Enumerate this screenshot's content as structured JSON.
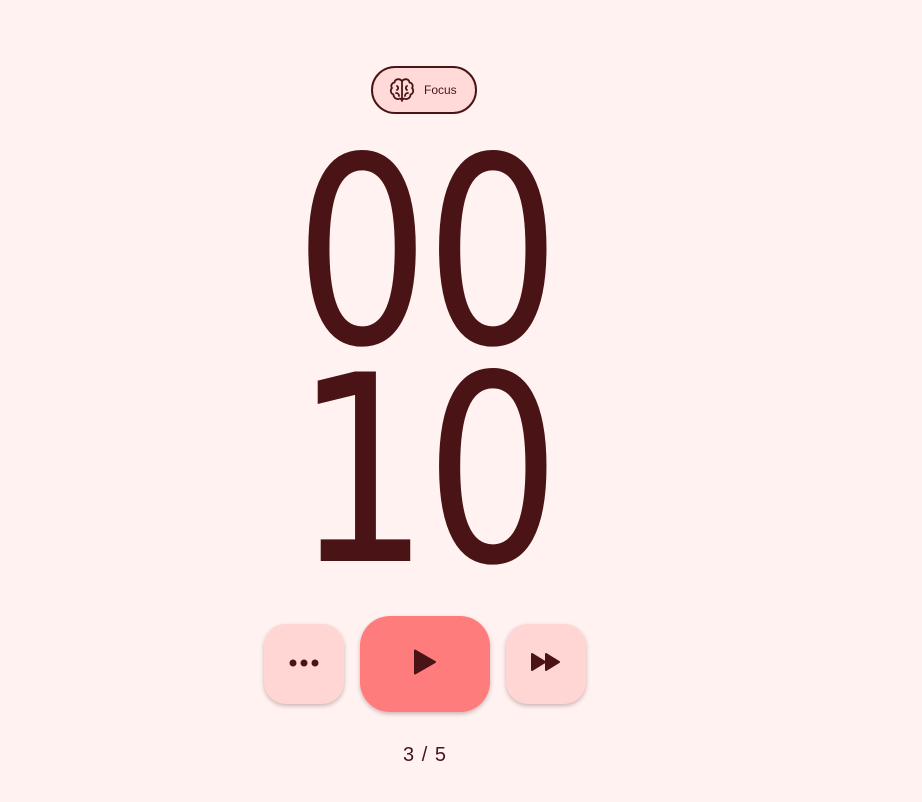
{
  "mode_chip": {
    "icon": "brain-icon",
    "label": "Focus"
  },
  "timer": {
    "minutes": "00",
    "seconds": "10"
  },
  "controls": {
    "more_icon": "more-horizontal-icon",
    "play_icon": "play-icon",
    "skip_icon": "fast-forward-icon"
  },
  "session": {
    "counter": "3 / 5"
  },
  "colors": {
    "background": "#fff2f1",
    "text": "#4a1416",
    "chip_bg": "#ffdad8",
    "secondary_button": "#ffd6d4",
    "primary_button": "#ff7c7c"
  }
}
